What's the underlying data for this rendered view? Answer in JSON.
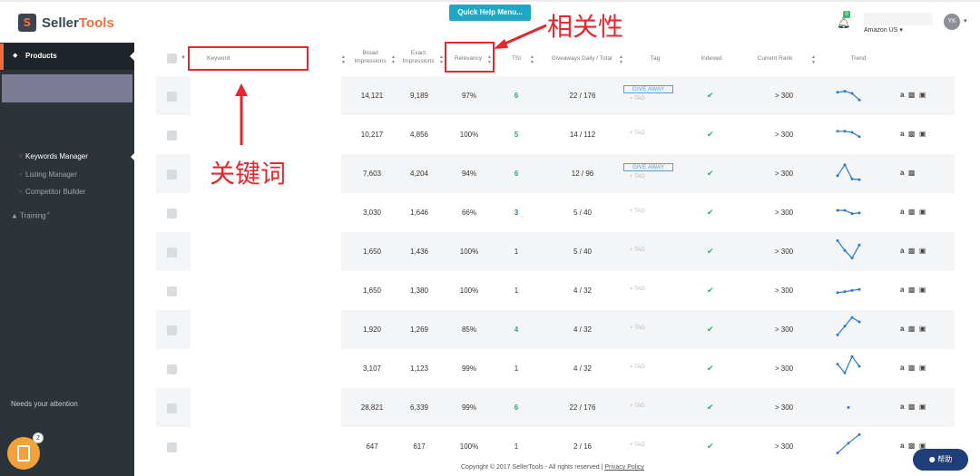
{
  "app": {
    "logo_mark": "S",
    "logo_text_1": "Seller",
    "logo_text_2": "Tools",
    "quick_help": "Quick Help Menu...",
    "notif_count": "0",
    "marketplace": "Amazon US",
    "avatar_initials": "YK"
  },
  "sidebar": {
    "products": "Products",
    "items": [
      {
        "label": "Keywords Manager"
      },
      {
        "label": "Listing Manager"
      },
      {
        "label": "Competitor Builder"
      }
    ],
    "training": "Training",
    "attention": "Needs your attention",
    "clip_count": "2"
  },
  "table": {
    "headers": {
      "keyword": "Keyword",
      "broad_1": "Broad",
      "broad_2": "Impressions",
      "exact_1": "Exact",
      "exact_2": "Impressions",
      "relevancy": "Relevancy",
      "tsi": "TSI",
      "giveaways": "Giveaways Daily / Total",
      "tag": "Tag",
      "indexed": "Indexed",
      "current_rank": "Current Rank",
      "trend": "Trend"
    },
    "tag_add": "+ TAG",
    "giveaway_label": "GIVE AWAY",
    "rows": [
      {
        "broad": "14,121",
        "exact": "9,189",
        "relevancy": "97%",
        "tsi": "6",
        "giveaways": "22 / 176",
        "giveaway": true,
        "rank": "> 300",
        "trend": [
          0.55,
          0.6,
          0.5,
          0.2
        ]
      },
      {
        "broad": "10,217",
        "exact": "4,856",
        "relevancy": "100%",
        "tsi": "5",
        "giveaways": "14 / 112",
        "giveaway": false,
        "rank": "> 300",
        "trend": [
          0.55,
          0.55,
          0.5,
          0.3
        ]
      },
      {
        "broad": "7,603",
        "exact": "4,204",
        "relevancy": "94%",
        "tsi": "6",
        "giveaways": "12 / 96",
        "giveaway": true,
        "rank": "> 300",
        "trend": [
          0.3,
          0.8,
          0.15,
          0.12
        ]
      },
      {
        "broad": "3,030",
        "exact": "1,646",
        "relevancy": "66%",
        "tsi": "3",
        "giveaways": "5 / 40",
        "giveaway": false,
        "rank": "> 300",
        "trend": [
          0.5,
          0.5,
          0.35,
          0.38
        ]
      },
      {
        "broad": "1,650",
        "exact": "1,436",
        "relevancy": "100%",
        "tsi": "1",
        "giveaways": "5 / 40",
        "giveaway": false,
        "rank": "> 300",
        "trend": [
          0.9,
          0.45,
          0.1,
          0.7
        ]
      },
      {
        "broad": "1,650",
        "exact": "1,380",
        "relevancy": "100%",
        "tsi": "1",
        "giveaways": "4 / 32",
        "giveaway": false,
        "rank": "> 300",
        "trend": [
          0.3,
          0.35,
          0.4,
          0.45
        ]
      },
      {
        "broad": "1,920",
        "exact": "1,269",
        "relevancy": "85%",
        "tsi": "4",
        "giveaways": "4 / 32",
        "giveaway": false,
        "rank": "> 300",
        "trend": [
          0.15,
          0.55,
          0.95,
          0.75
        ]
      },
      {
        "broad": "3,107",
        "exact": "1,123",
        "relevancy": "99%",
        "tsi": "1",
        "giveaways": "4 / 32",
        "giveaway": false,
        "rank": "> 300",
        "trend": [
          0.6,
          0.2,
          0.95,
          0.5
        ]
      },
      {
        "broad": "28,821",
        "exact": "6,339",
        "relevancy": "99%",
        "tsi": "6",
        "giveaways": "22 / 176",
        "giveaway": false,
        "rank": "> 300",
        "trend": [
          0.4
        ]
      },
      {
        "broad": "647",
        "exact": "617",
        "relevancy": "100%",
        "tsi": "1",
        "giveaways": "2 / 16",
        "giveaway": false,
        "rank": "> 300",
        "trend": [
          0.1,
          0.55,
          0.95
        ]
      }
    ]
  },
  "annotations": {
    "relevancy_cn": "相关性",
    "keyword_cn": "关键词"
  },
  "footer": {
    "text": "Copyright © 2017 SellerTools - All rights reserved | ",
    "link": "Privacy Policy"
  },
  "help_button": "帮助",
  "colors": {
    "accent": "#f26b3a",
    "sidebar": "#2d3439",
    "annotation": "#e8262d",
    "tsi_high": "#2ea86a"
  }
}
